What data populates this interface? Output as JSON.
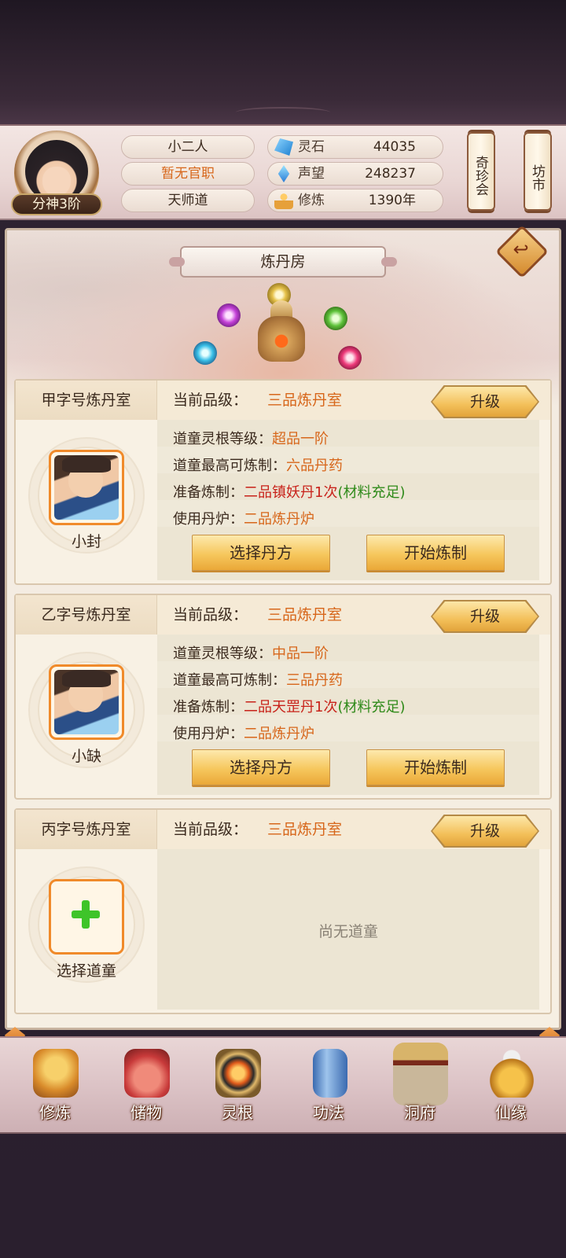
{
  "header": {
    "rank": "分神3阶",
    "player_name": "小二人",
    "official_title": "暂无官职",
    "sect": "天师道",
    "resources": [
      {
        "icon": "spirit-stone-icon",
        "label": "灵石",
        "value": "44035"
      },
      {
        "icon": "reputation-icon",
        "label": "声望",
        "value": "248237"
      },
      {
        "icon": "cultivation-icon",
        "label": "修炼",
        "value": "1390年"
      }
    ],
    "shop_buttons": [
      "奇珍会",
      "坊市"
    ]
  },
  "page": {
    "title": "炼丹房"
  },
  "rooms": [
    {
      "name": "甲字号炼丹室",
      "current_label": "当前品级：",
      "current_value": "三品炼丹室",
      "upgrade_label": "升级",
      "taoist_name": "小封",
      "lines": [
        {
          "label": "道童灵根等级：",
          "value": "超品一阶"
        },
        {
          "label": "道童最高可炼制：",
          "value": "六品丹药"
        },
        {
          "label": "准备炼制：",
          "value": "二品镇妖丹1次",
          "extra": "(材料充足)"
        },
        {
          "label": "使用丹炉：",
          "value": "二品炼丹炉"
        }
      ],
      "select_label": "选择丹方",
      "start_label": "开始炼制"
    },
    {
      "name": "乙字号炼丹室",
      "current_label": "当前品级：",
      "current_value": "三品炼丹室",
      "upgrade_label": "升级",
      "taoist_name": "小缺",
      "lines": [
        {
          "label": "道童灵根等级：",
          "value": "中品一阶"
        },
        {
          "label": "道童最高可炼制：",
          "value": "三品丹药"
        },
        {
          "label": "准备炼制：",
          "value": "二品天罡丹1次",
          "extra": "(材料充足)"
        },
        {
          "label": "使用丹炉：",
          "value": "二品炼丹炉"
        }
      ],
      "select_label": "选择丹方",
      "start_label": "开始炼制"
    },
    {
      "name": "丙字号炼丹室",
      "current_label": "当前品级：",
      "current_value": "三品炼丹室",
      "upgrade_label": "升级",
      "select_taoist_label": "选择道童",
      "empty_text": "尚无道童"
    }
  ],
  "nav": [
    {
      "icon": "meditation-icon",
      "label": "修炼"
    },
    {
      "icon": "bag-icon",
      "label": "储物"
    },
    {
      "icon": "spirit-root-icon",
      "label": "灵根"
    },
    {
      "icon": "scripture-icon",
      "label": "功法"
    },
    {
      "icon": "cave-palace-icon",
      "label": "洞府"
    },
    {
      "icon": "gourd-icon",
      "label": "仙缘"
    }
  ]
}
